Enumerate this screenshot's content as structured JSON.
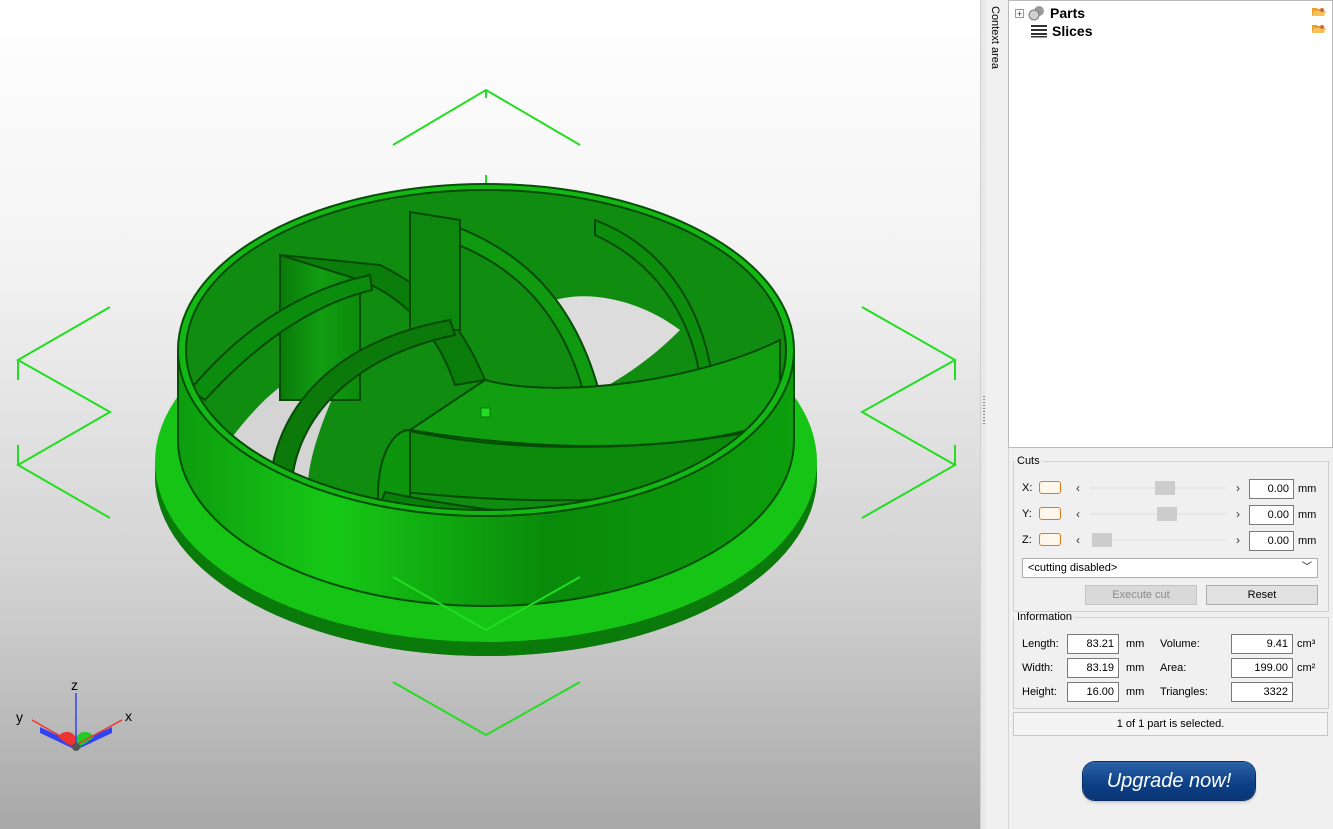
{
  "viewport": {
    "axis_labels": {
      "x": "x",
      "y": "y",
      "z": "z"
    },
    "model_color": "#12c412",
    "handle_color": "#22dd22"
  },
  "context_tab": {
    "label": "Context area"
  },
  "tree": {
    "items": [
      {
        "label": "Parts",
        "icon": "parts-icon"
      },
      {
        "label": "Slices",
        "icon": "slices-icon"
      }
    ]
  },
  "cuts": {
    "title": "Cuts",
    "axes": [
      {
        "label": "X:",
        "value": "0.00",
        "unit": "mm",
        "position": 0.45
      },
      {
        "label": "Y:",
        "value": "0.00",
        "unit": "mm",
        "position": 0.46
      },
      {
        "label": "Z:",
        "value": "0.00",
        "unit": "mm",
        "position": 0.0
      }
    ],
    "mode": "<cutting disabled>",
    "execute_label": "Execute cut",
    "reset_label": "Reset"
  },
  "info": {
    "title": "Information",
    "length_label": "Length:",
    "length": "83.21",
    "length_unit": "mm",
    "width_label": "Width:",
    "width": "83.19",
    "width_unit": "mm",
    "height_label": "Height:",
    "height": "16.00",
    "height_unit": "mm",
    "volume_label": "Volume:",
    "volume": "9.41",
    "volume_unit": "cm³",
    "area_label": "Area:",
    "area": "199.00",
    "area_unit": "cm²",
    "triangles_label": "Triangles:",
    "triangles": "3322"
  },
  "status": {
    "text": "1 of 1 part is selected."
  },
  "upgrade": {
    "label": "Upgrade now!"
  }
}
